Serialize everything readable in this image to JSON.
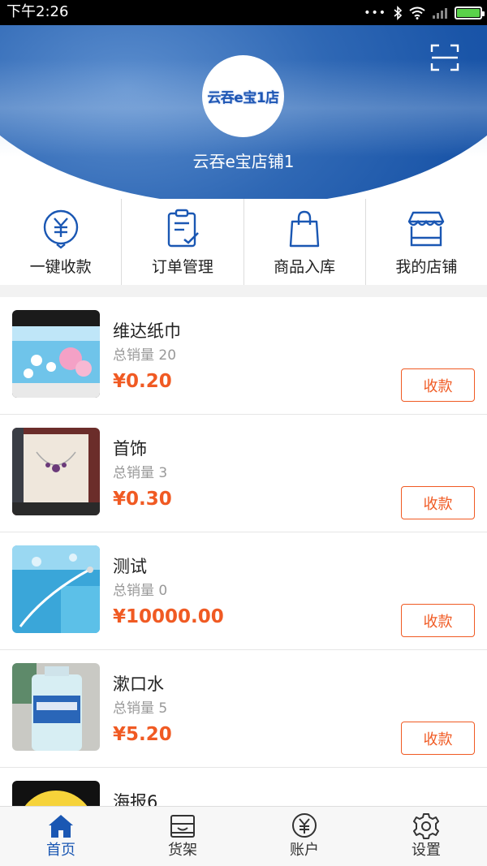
{
  "status_bar": {
    "time": "下午2:26",
    "dots": "•••"
  },
  "header": {
    "avatar_text": "云吞e宝1店",
    "shop_name": "云吞e宝店铺1"
  },
  "quick_actions": [
    {
      "label": "一键收款",
      "icon": "yen-circle-icon"
    },
    {
      "label": "订单管理",
      "icon": "clipboard-check-icon"
    },
    {
      "label": "商品入库",
      "icon": "shopping-bag-icon"
    },
    {
      "label": "我的店铺",
      "icon": "storefront-icon"
    }
  ],
  "products": [
    {
      "name": "维达纸巾",
      "sales": "总销量 20",
      "price": "¥0.20",
      "action": "收款"
    },
    {
      "name": "首饰",
      "sales": "总销量 3",
      "price": "¥0.30",
      "action": "收款"
    },
    {
      "name": "测试",
      "sales": "总销量 0",
      "price": "¥10000.00",
      "action": "收款"
    },
    {
      "name": "漱口水",
      "sales": "总销量 5",
      "price": "¥5.20",
      "action": "收款"
    },
    {
      "name": "海报6",
      "sales": "",
      "price": "",
      "action": ""
    }
  ],
  "tabs": [
    {
      "label": "首页",
      "icon": "home-icon",
      "active": true
    },
    {
      "label": "货架",
      "icon": "shelf-icon",
      "active": false
    },
    {
      "label": "账户",
      "icon": "yen-circle-icon",
      "active": false
    },
    {
      "label": "设置",
      "icon": "gear-icon",
      "active": false
    }
  ],
  "colors": {
    "brand_blue": "#1a57b3",
    "price_orange": "#f05a23"
  }
}
